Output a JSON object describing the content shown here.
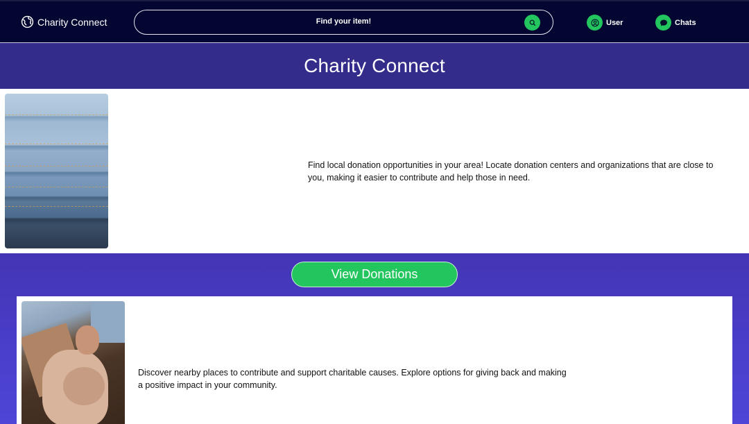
{
  "header": {
    "brand": "Charity Connect",
    "search_placeholder": "Find your item!",
    "nav_user": "User",
    "nav_chats": "Chats"
  },
  "hero": {
    "title": "Charity Connect"
  },
  "section1": {
    "description": "Find local donation opportunities in your area! Locate donation centers and organizations that are close to you, making it easier to contribute and help those in need."
  },
  "section2": {
    "button_label": "View Donations",
    "description": "Discover nearby places to contribute and support charitable causes. Explore options for giving back and making a positive impact in your community."
  },
  "colors": {
    "topbar": "#030631",
    "hero": "#332c8b",
    "accent_green": "#23c55e",
    "band": "#4a3fcc"
  }
}
